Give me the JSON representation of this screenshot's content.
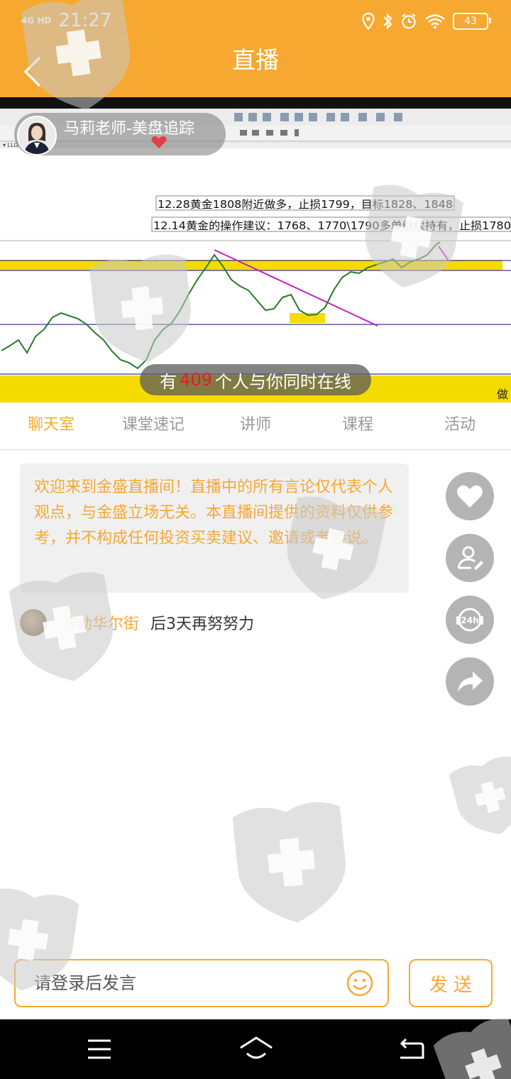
{
  "status_bar": {
    "network_type": "4G HD",
    "time": "21:27",
    "battery_level": "43"
  },
  "header": {
    "title": "直播"
  },
  "video": {
    "host_name": "马莉老师-美盘追踪",
    "chart_annotations": [
      "12.28黄金1808附近做多，止损1799，目标1828、1848",
      "12.14黄金的操作建议：1768、1770\\1790多单继续持有，止损1780"
    ],
    "chart_corner_text": "做",
    "online_prefix": "有",
    "online_count": "409",
    "online_suffix": "个人与你同时在线"
  },
  "tabs": [
    {
      "label": "聊天室",
      "active": true
    },
    {
      "label": "课堂速记",
      "active": false
    },
    {
      "label": "讲师",
      "active": false
    },
    {
      "label": "课程",
      "active": false
    },
    {
      "label": "活动",
      "active": false
    }
  ],
  "chat": {
    "notice": "欢迎来到金盛直播间！直播中的所有言论仅代表个人观点，与金盛立场无关。本直播间提供的资料仅供参考，并不构成任何投资买卖建议、邀请或者游说。",
    "messages": [
      {
        "user": "洗劫华尔街",
        "text": "后3天再努努力"
      }
    ]
  },
  "side_actions": [
    "heart-icon",
    "follow-teacher-icon",
    "service-24h-icon",
    "share-icon"
  ],
  "input": {
    "placeholder": "请登录后发言",
    "send_label": "发送"
  },
  "colors": {
    "accent": "#f7a830",
    "online_count": "#e51c23",
    "side_button": "#b4b4b4"
  }
}
